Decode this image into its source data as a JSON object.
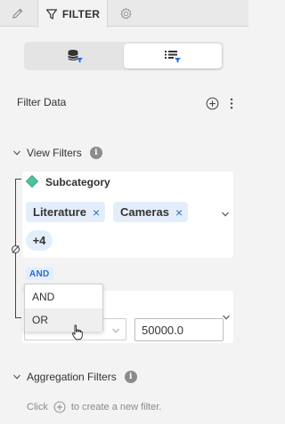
{
  "tabs": {
    "filter_label": "FILTER"
  },
  "panel": {
    "filter_data_label": "Filter Data"
  },
  "view_filters": {
    "heading": "View Filters",
    "info": "i",
    "subcategory": {
      "title": "Subcategory",
      "chips": [
        "Literature",
        "Cameras"
      ],
      "chip_remove": "×",
      "more": "+4"
    },
    "operator_badge": "AND",
    "operator_menu": {
      "options": [
        "AND",
        "OR"
      ],
      "hovered": "OR"
    },
    "value_input": "50000.0"
  },
  "aggregation_filters": {
    "heading": "Aggregation Filters",
    "info": "i",
    "hint_before": "Click",
    "hint_after": "to create a new filter."
  },
  "colors": {
    "accent": "#2a6ad6",
    "chip_bg": "#e4eefb",
    "dimension_marker": "#4fc3a1"
  }
}
